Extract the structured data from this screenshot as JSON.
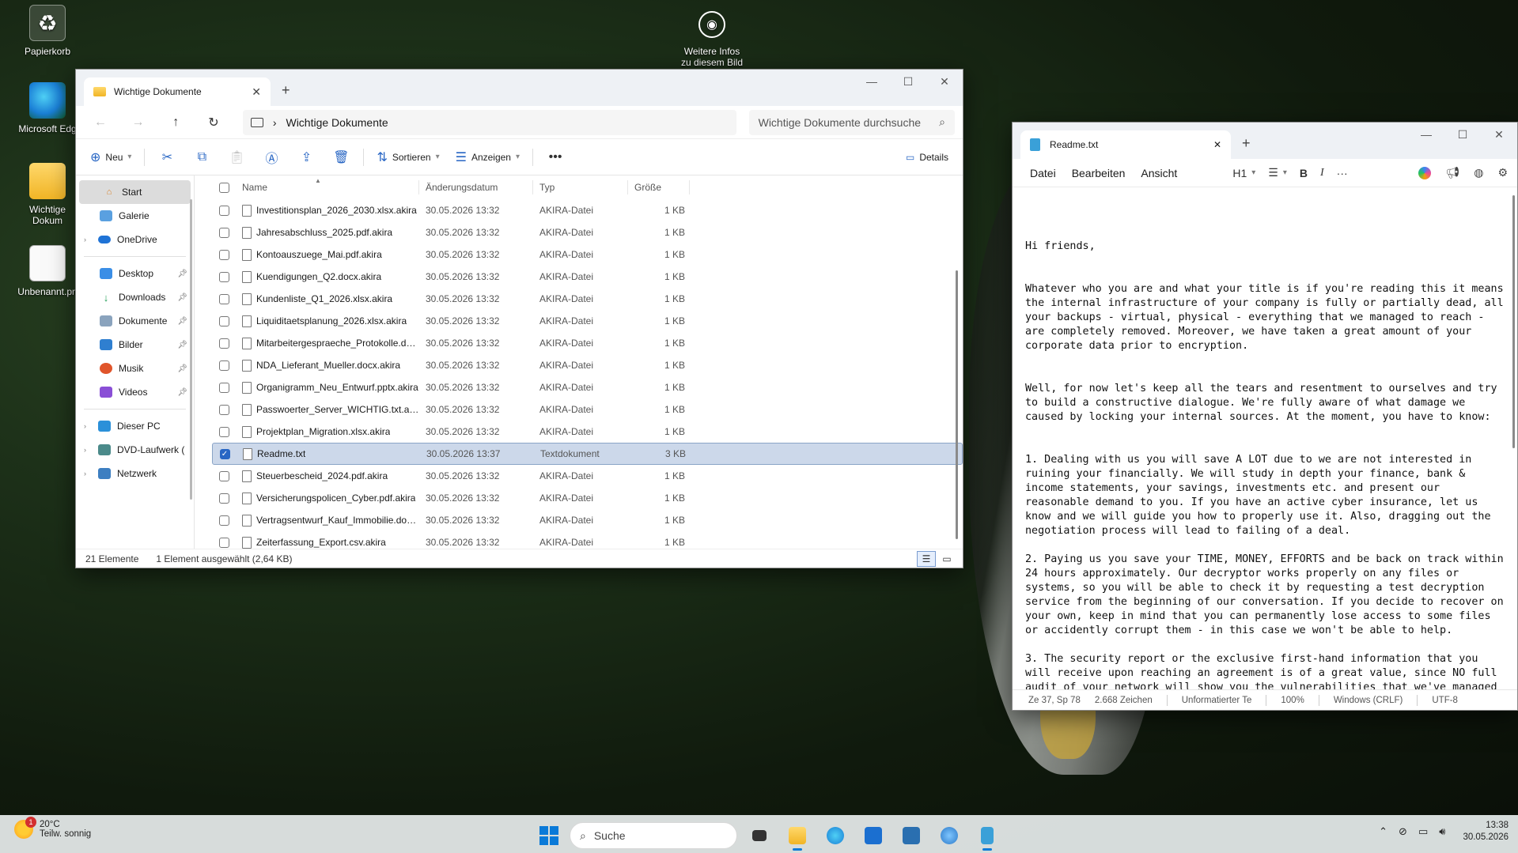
{
  "desktop": {
    "icons": [
      {
        "label": "Papierkorb"
      },
      {
        "label": "Microsoft Edg"
      },
      {
        "label": "Wichtige Dokum"
      },
      {
        "label": "Unbenannt.pn"
      }
    ],
    "info_label": "Weitere Infos zu diesem Bild"
  },
  "explorer": {
    "tab_title": "Wichtige Dokumente",
    "path": "Wichtige Dokumente",
    "search_placeholder": "Wichtige Dokumente durchsuche",
    "cmd": {
      "new": "Neu",
      "sort": "Sortieren",
      "view": "Anzeigen",
      "details": "Details"
    },
    "sidebar": {
      "start": "Start",
      "gallery": "Galerie",
      "onedrive": "OneDrive",
      "desktop": "Desktop",
      "downloads": "Downloads",
      "documents": "Dokumente",
      "pictures": "Bilder",
      "music": "Musik",
      "videos": "Videos",
      "this_pc": "Dieser PC",
      "dvd": "DVD-Laufwerk (",
      "network": "Netzwerk"
    },
    "columns": {
      "name": "Name",
      "date": "Änderungsdatum",
      "type": "Typ",
      "size": "Größe"
    },
    "files": [
      {
        "name": "Investitionsplan_2026_2030.xlsx.akira",
        "date": "30.05.2026 13:32",
        "type": "AKIRA-Datei",
        "size": "1 KB"
      },
      {
        "name": "Jahresabschluss_2025.pdf.akira",
        "date": "30.05.2026 13:32",
        "type": "AKIRA-Datei",
        "size": "1 KB"
      },
      {
        "name": "Kontoauszuege_Mai.pdf.akira",
        "date": "30.05.2026 13:32",
        "type": "AKIRA-Datei",
        "size": "1 KB"
      },
      {
        "name": "Kuendigungen_Q2.docx.akira",
        "date": "30.05.2026 13:32",
        "type": "AKIRA-Datei",
        "size": "1 KB"
      },
      {
        "name": "Kundenliste_Q1_2026.xlsx.akira",
        "date": "30.05.2026 13:32",
        "type": "AKIRA-Datei",
        "size": "1 KB"
      },
      {
        "name": "Liquiditaetsplanung_2026.xlsx.akira",
        "date": "30.05.2026 13:32",
        "type": "AKIRA-Datei",
        "size": "1 KB"
      },
      {
        "name": "Mitarbeitergespraeche_Protokolle.doc...",
        "date": "30.05.2026 13:32",
        "type": "AKIRA-Datei",
        "size": "1 KB"
      },
      {
        "name": "NDA_Lieferant_Mueller.docx.akira",
        "date": "30.05.2026 13:32",
        "type": "AKIRA-Datei",
        "size": "1 KB"
      },
      {
        "name": "Organigramm_Neu_Entwurf.pptx.akira",
        "date": "30.05.2026 13:32",
        "type": "AKIRA-Datei",
        "size": "1 KB"
      },
      {
        "name": "Passwoerter_Server_WICHTIG.txt.akira",
        "date": "30.05.2026 13:32",
        "type": "AKIRA-Datei",
        "size": "1 KB"
      },
      {
        "name": "Projektplan_Migration.xlsx.akira",
        "date": "30.05.2026 13:32",
        "type": "AKIRA-Datei",
        "size": "1 KB"
      },
      {
        "name": "Readme.txt",
        "date": "30.05.2026 13:37",
        "type": "Textdokument",
        "size": "3 KB",
        "selected": true
      },
      {
        "name": "Steuerbescheid_2024.pdf.akira",
        "date": "30.05.2026 13:32",
        "type": "AKIRA-Datei",
        "size": "1 KB"
      },
      {
        "name": "Versicherungspolicen_Cyber.pdf.akira",
        "date": "30.05.2026 13:32",
        "type": "AKIRA-Datei",
        "size": "1 KB"
      },
      {
        "name": "Vertragsentwurf_Kauf_Immobilie.docx....",
        "date": "30.05.2026 13:32",
        "type": "AKIRA-Datei",
        "size": "1 KB"
      },
      {
        "name": "Zeiterfassung_Export.csv.akira",
        "date": "30.05.2026 13:32",
        "type": "AKIRA-Datei",
        "size": "1 KB"
      }
    ],
    "status": {
      "count": "21 Elemente",
      "selection": "1 Element ausgewählt (2,64 KB)"
    }
  },
  "notepad": {
    "tab_title": "Readme.txt",
    "menu": {
      "file": "Datei",
      "edit": "Bearbeiten",
      "view": "Ansicht"
    },
    "heading_select": "H1",
    "paragraphs": [
      "Hi friends,",
      "",
      "",
      "Whatever who you are and what your title is if you're reading this it means the internal infrastructure of your company is fully or partially dead, all your backups - virtual, physical - everything that we managed to reach - are completely removed. Moreover, we have taken a great amount of your corporate data prior to encryption.",
      "",
      "",
      "Well, for now let's keep all the tears and resentment to ourselves and try to build a constructive dialogue. We're fully aware of what damage we caused by locking your internal sources. At the moment, you have to know:",
      "",
      "",
      "1. Dealing with us you will save A LOT due to we are not interested in ruining your financially. We will study in depth your finance, bank & income statements, your savings, investments etc. and present our reasonable demand to you. If you have an active cyber insurance, let us know and we will guide you how to properly use it. Also, dragging out the negotiation process will lead to failing of a deal.",
      "",
      "2. Paying us you save your TIME, MONEY, EFFORTS and be back on track within 24 hours approximately. Our decryptor works properly on any files or systems, so you will be able to check it by requesting a test decryption service from the beginning of our conversation. If you decide to recover on your own, keep in mind that you can permanently lose access to some files or accidently corrupt them - in this case we won't be able to help.",
      "",
      "3. The security report or the exclusive first-hand information that you will receive upon reaching an agreement is of a great value, since NO full audit of your network will show you the vulnerabilities that we've managed"
    ],
    "status": {
      "position": "Ze 37, Sp 78",
      "chars": "2.668 Zeichen",
      "format": "Unformatierter Te",
      "zoom": "100%",
      "line_ending": "Windows (CRLF)",
      "encoding": "UTF-8"
    }
  },
  "taskbar": {
    "temp": "20°C",
    "condition": "Teilw. sonnig",
    "notif_count": "1",
    "search_label": "Suche",
    "time": "13:38",
    "date": "30.05.2026"
  }
}
